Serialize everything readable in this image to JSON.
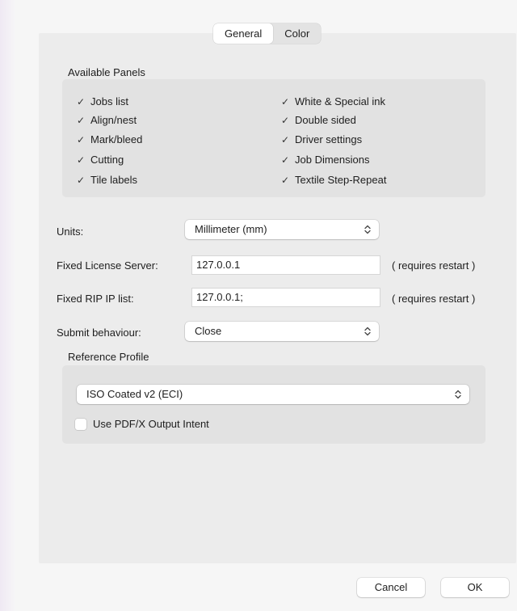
{
  "tabs": [
    {
      "label": "General",
      "active": true
    },
    {
      "label": "Color",
      "active": false
    }
  ],
  "available_panels": {
    "title": "Available Panels",
    "left": [
      {
        "label": "Jobs list",
        "checked": true
      },
      {
        "label": "Align/nest",
        "checked": true
      },
      {
        "label": "Mark/bleed",
        "checked": true
      },
      {
        "label": "Cutting",
        "checked": true
      },
      {
        "label": "Tile labels",
        "checked": true
      }
    ],
    "right": [
      {
        "label": "White & Special ink",
        "checked": true
      },
      {
        "label": "Double sided",
        "checked": true
      },
      {
        "label": "Driver settings",
        "checked": true
      },
      {
        "label": "Job Dimensions",
        "checked": true
      },
      {
        "label": "Textile Step-Repeat",
        "checked": true
      }
    ]
  },
  "units": {
    "label": "Units:",
    "value": "Millimeter (mm)"
  },
  "license_server": {
    "label": "Fixed License Server:",
    "value": "127.0.0.1",
    "hint": "( requires restart )"
  },
  "rip_ip_list": {
    "label": "Fixed RIP IP list:",
    "value": "127.0.0.1;",
    "hint": "( requires restart )"
  },
  "submit_behaviour": {
    "label": "Submit behaviour:",
    "value": "Close"
  },
  "reference_profile": {
    "title": "Reference Profile",
    "profile": "ISO Coated v2 (ECI)",
    "use_output_intent": {
      "label": "Use PDF/X Output Intent",
      "checked": false
    }
  },
  "buttons": {
    "cancel": "Cancel",
    "ok": "OK"
  },
  "icons": {
    "check": "checkmark-icon",
    "stepper": "up-down-chevron-icon"
  }
}
